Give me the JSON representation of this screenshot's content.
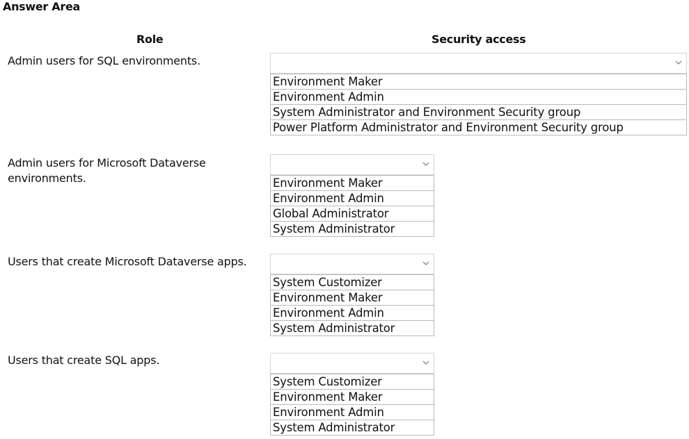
{
  "title": "Answer Area",
  "headers": {
    "role": "Role",
    "security": "Security access"
  },
  "rows": [
    {
      "role": "Admin users for SQL environments.",
      "selected": "",
      "options": [
        "Environment Maker",
        "Environment Admin",
        "System Administrator and Environment Security group",
        "Power Platform Administrator and Environment Security group"
      ]
    },
    {
      "role": "Admin users for Microsoft Dataverse environments.",
      "selected": "",
      "options": [
        "Environment Maker",
        "Environment Admin",
        "Global Administrator",
        "System Administrator"
      ]
    },
    {
      "role": "Users that create Microsoft Dataverse apps.",
      "selected": "",
      "options": [
        "System Customizer",
        "Environment Maker",
        "Environment Admin",
        "System Administrator"
      ]
    },
    {
      "role": "Users that create SQL apps.",
      "selected": "",
      "options": [
        "System Customizer",
        "Environment Maker",
        "Environment Admin",
        "System Administrator"
      ]
    }
  ],
  "icons": {
    "dropdown": "chevron-down-icon"
  }
}
